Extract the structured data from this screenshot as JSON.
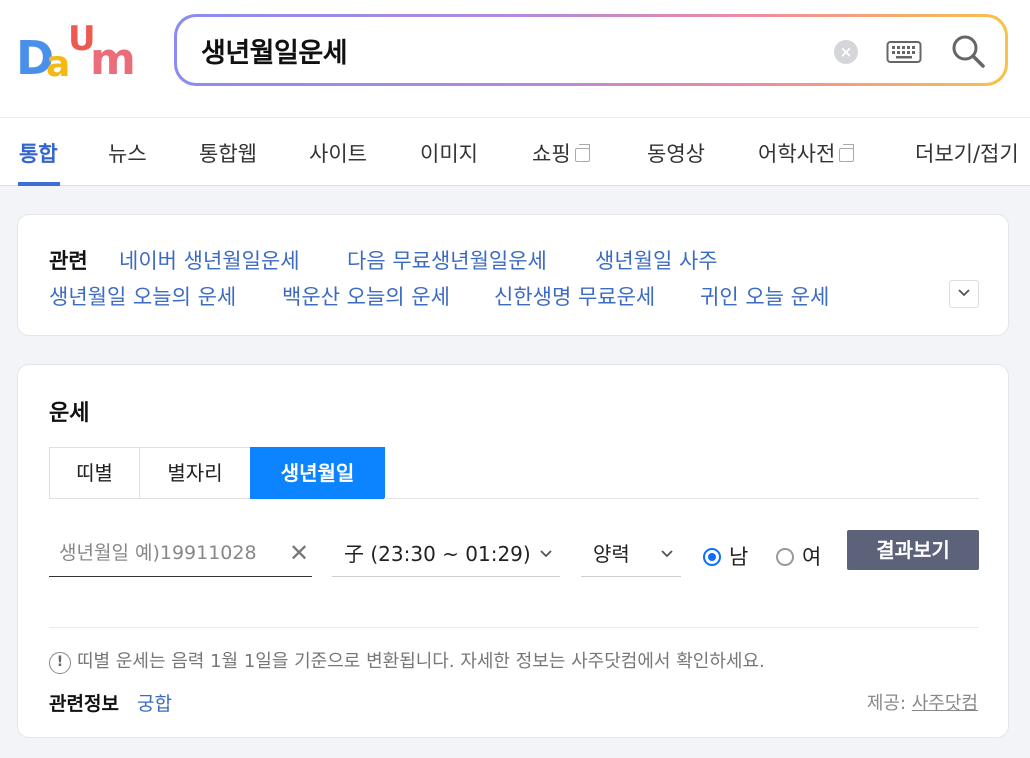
{
  "header": {
    "logo_letters": [
      "D",
      "a",
      "U",
      "m"
    ],
    "search_query": "생년월일운세",
    "clear_label": "×"
  },
  "tabs": [
    {
      "label": "통합",
      "active": true
    },
    {
      "label": "뉴스"
    },
    {
      "label": "통합웹"
    },
    {
      "label": "사이트"
    },
    {
      "label": "이미지"
    },
    {
      "label": "쇼핑",
      "external": true
    },
    {
      "label": "동영상"
    },
    {
      "label": "어학사전",
      "external": true
    },
    {
      "label": "더보기/접기"
    }
  ],
  "related": {
    "title": "관련",
    "links": [
      "네이버 생년월일운세",
      "다음 무료생년월일운세",
      "생년월일 사주",
      "생년월일 오늘의 운세",
      "백운산 오늘의 운세",
      "신한생명 무료운세",
      "귀인 오늘 운세"
    ],
    "expand_icon": "chevron-down-icon"
  },
  "fortune": {
    "title": "운세",
    "segments": [
      {
        "label": "띠별"
      },
      {
        "label": "별자리"
      },
      {
        "label": "생년월일",
        "active": true
      }
    ],
    "birth_placeholder": "생년월일 예)19911028",
    "birth_clear": "✕",
    "time_select": "子 (23:30 ~ 01:29)",
    "calendar_select": "양력",
    "gender_options": [
      {
        "label": "남",
        "selected": true
      },
      {
        "label": "여",
        "selected": false
      }
    ],
    "result_button": "결과보기",
    "notice_icon": "!",
    "notice": "띠별 운세는 음력 1월 1일을 기준으로 변환됩니다. 자세한 정보는 사주닷컴에서 확인하세요.",
    "info_label": "관련정보",
    "info_link": "궁합",
    "provider_label": "제공:",
    "provider_link": "사주닷컴"
  },
  "colors": {
    "accent_blue": "#0d84ff",
    "link_blue": "#3c6bc4",
    "result_button_bg": "#5c6279"
  }
}
